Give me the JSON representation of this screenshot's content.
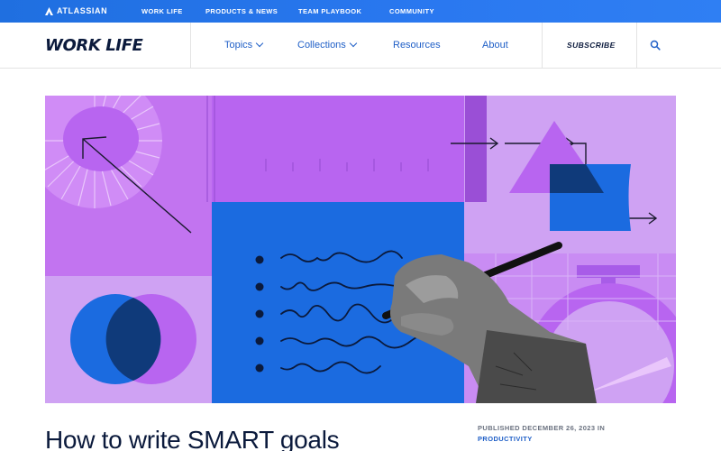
{
  "topbar": {
    "brand": "ATLASSIAN",
    "links": [
      "WORK LIFE",
      "PRODUCTS & NEWS",
      "TEAM PLAYBOOK",
      "COMMUNITY"
    ]
  },
  "nav": {
    "logo": "WORK LIFE",
    "items": [
      {
        "label": "Topics",
        "dropdown": true
      },
      {
        "label": "Collections",
        "dropdown": true
      },
      {
        "label": "Resources",
        "dropdown": false
      },
      {
        "label": "About",
        "dropdown": false
      }
    ],
    "subscribe": "SUBSCRIBE",
    "search_icon": "search-icon"
  },
  "hero": {
    "icons": [
      "arrow-up-left",
      "triangle-shape",
      "stopwatch-shape",
      "venn-circles",
      "hand-with-pen",
      "bulleted-scribble-list"
    ]
  },
  "article": {
    "published": "PUBLISHED DECEMBER 26, 2023 IN",
    "category": "PRODUCTIVITY",
    "title": "How to write SMART goals"
  },
  "colors": {
    "brand_blue": "#1f6fe0",
    "ink": "#0b1a3c",
    "purple": "#b865f0",
    "light_purple": "#cfa2f3",
    "blue": "#1b6be0"
  }
}
